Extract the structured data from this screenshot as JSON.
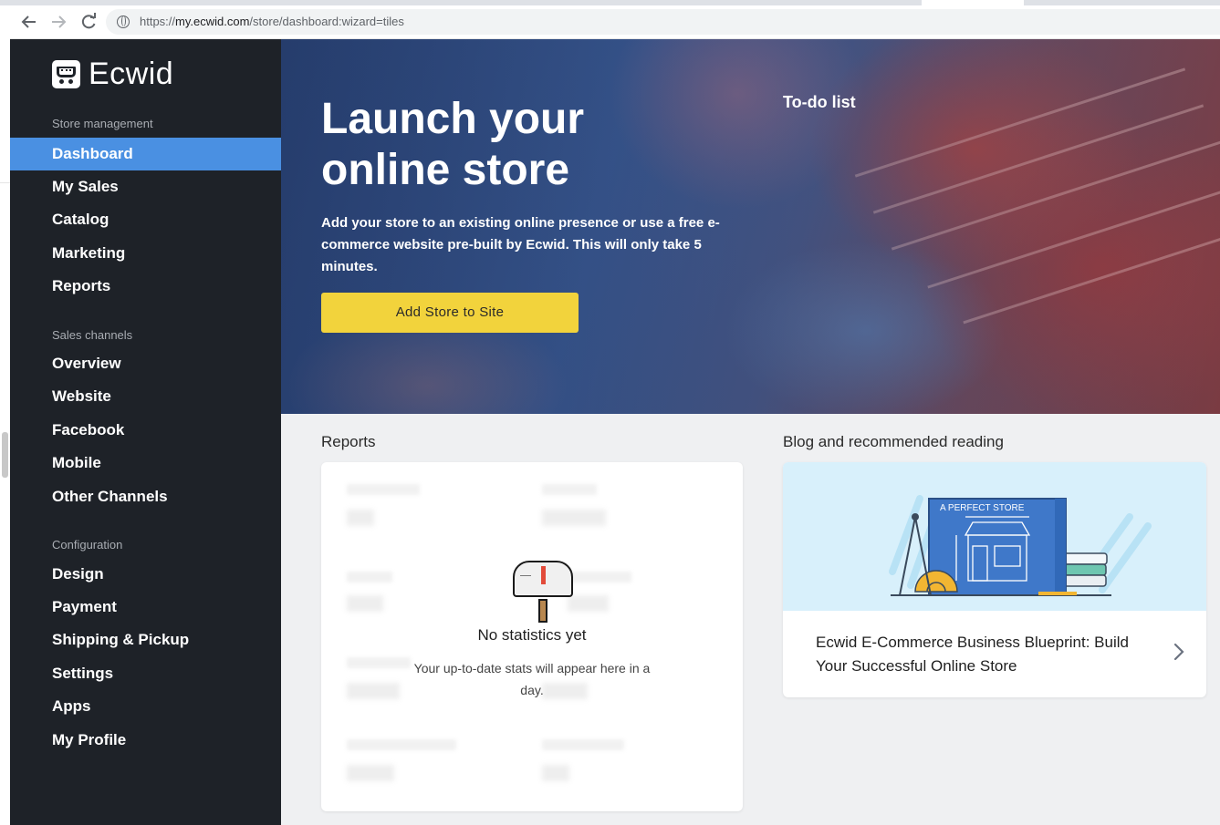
{
  "browser": {
    "url_prefix": "https://",
    "url_host": "my.ecwid.com",
    "url_path": "/store/dashboard:wizard=tiles"
  },
  "sidebar": {
    "logo_text": "Ecwid",
    "sections": [
      {
        "label": "Store management",
        "items": [
          {
            "label": "Dashboard",
            "active": true
          },
          {
            "label": "My Sales"
          },
          {
            "label": "Catalog"
          },
          {
            "label": "Marketing"
          },
          {
            "label": "Reports"
          }
        ]
      },
      {
        "label": "Sales channels",
        "items": [
          {
            "label": "Overview"
          },
          {
            "label": "Website"
          },
          {
            "label": "Facebook"
          },
          {
            "label": "Mobile"
          },
          {
            "label": "Other Channels"
          }
        ]
      },
      {
        "label": "Configuration",
        "items": [
          {
            "label": "Design"
          },
          {
            "label": "Payment"
          },
          {
            "label": "Shipping & Pickup"
          },
          {
            "label": "Settings"
          },
          {
            "label": "Apps"
          },
          {
            "label": "My Profile"
          }
        ]
      }
    ]
  },
  "hero": {
    "title": "Launch your online store",
    "description": "Add your store to an existing online presence or use a free e-commerce website pre-built by Ecwid. This will only take 5 minutes.",
    "button_label": "Add Store to Site",
    "todo_label": "To-do list"
  },
  "reports": {
    "title": "Reports",
    "empty_title": "No statistics yet",
    "empty_subtitle": "Your up-to-date stats will appear here in a day."
  },
  "blog": {
    "title": "Blog and recommended reading",
    "image_caption": "A PERFECT STORE",
    "article_title": "Ecwid E-Commerce Business Blueprint: Build Your Successful Online Store"
  },
  "colors": {
    "sidebar_bg": "#1e2228",
    "active_item": "#4a90e2",
    "cta_button": "#f2d33c",
    "content_bg": "#eff0f2"
  },
  "icons": [
    "back-arrow-icon",
    "forward-arrow-icon",
    "reload-icon",
    "site-info-icon",
    "ecwid-cart-logo-icon",
    "mailbox-icon",
    "chevron-right-icon"
  ]
}
